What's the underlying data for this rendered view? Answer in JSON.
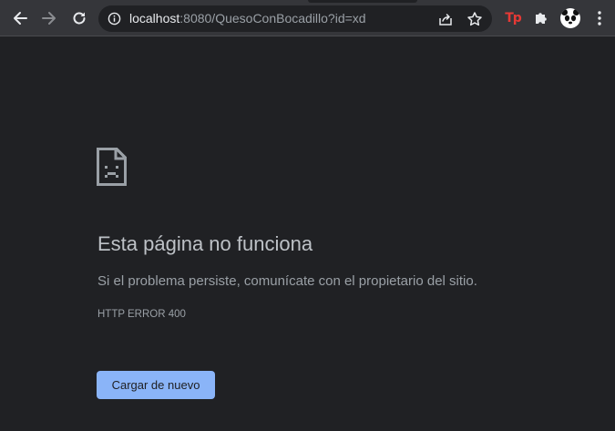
{
  "browser": {
    "url_host": "localhost",
    "url_rest": ":8080/QuesoConBocadillo?id=xd",
    "icons": {
      "back": "back-arrow-icon",
      "forward": "forward-arrow-icon",
      "reload": "reload-icon",
      "site_info": "info-icon",
      "share": "share-icon",
      "bookmark": "star-icon",
      "extension_tp": "tp-extension-icon",
      "extensions": "puzzle-icon",
      "profile": "panda-avatar",
      "menu": "three-dots-menu-icon"
    },
    "extension_tp_label": "Tp"
  },
  "error_page": {
    "icon": "sad-document-icon",
    "title": "Esta página no funciona",
    "message": "Si el problema persiste, comunícate con el propietario del sitio.",
    "error_code": "HTTP ERROR 400",
    "reload_label": "Cargar de nuevo"
  },
  "colors": {
    "background": "#202124",
    "toolbar": "#35363a",
    "accent_button": "#8ab4f8",
    "title_text": "#bdc1c6",
    "secondary_text": "#9aa0a6"
  }
}
